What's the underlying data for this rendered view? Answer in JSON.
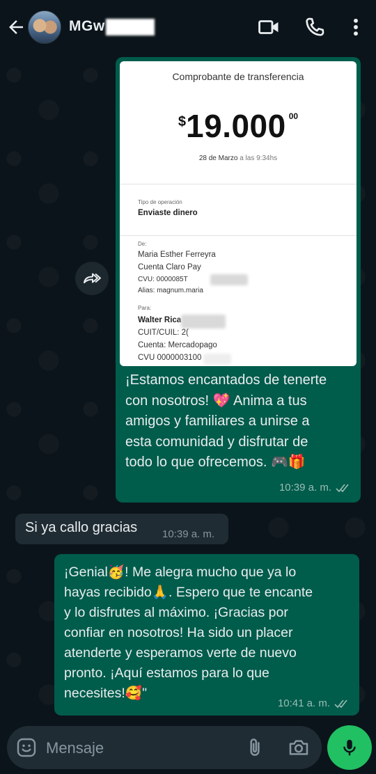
{
  "header": {
    "contact_name": "MGw",
    "icons": [
      "back-arrow-icon",
      "video-camera-icon",
      "phone-icon",
      "more-vert-icon"
    ]
  },
  "receipt": {
    "title": "Comprobante de transferencia",
    "currency": "$",
    "amount": "19.000",
    "cents": "00",
    "date_main": "28 de Marzo",
    "date_rest": " a las 9:34hs",
    "op_label": "Tipo de operación",
    "op_value": "Enviaste dinero",
    "from_label": "De:",
    "from_name": "Maria Esther Ferreyra",
    "from_account": "Cuenta Claro Pay",
    "from_cvu": "CVU: 0000085T",
    "from_alias": "Alias: magnum.maria",
    "to_label": "Para:",
    "to_name": "Walter Rica",
    "to_cuit": "CUIT/CUIL: 2(",
    "to_account": "Cuenta: Mercadopago",
    "to_cvu": "CVU 0000003100"
  },
  "messages": [
    {
      "direction": "out",
      "text": "¡Estamos encantados de tenerte\ncon nosotros! 💖 Anima a tus\namigos y familiares a unirse a\nesta comunidad y disfrutar de\ntodo lo que ofrecemos. 🎮🎁",
      "time": "10:39 a. m.",
      "status": "read"
    },
    {
      "direction": "in",
      "text": "Si ya callo gracias",
      "time": "10:39 a. m."
    },
    {
      "direction": "out",
      "text": "¡Genial🥳! Me alegra mucho que ya lo\nhayas recibido🙏. Espero que te encante\ny lo disfrutes al máximo. ¡Gracias por\nconfiar en nosotros! Ha sido un placer\natenderte y esperamos verte de nuevo\npronto. ¡Aquí estamos para lo que\nnecesites!🥰\"",
      "time": "10:41 a. m.",
      "status": "read"
    }
  ],
  "composer": {
    "placeholder": "Mensaje",
    "icons": [
      "emoji-icon",
      "paperclip-icon",
      "camera-icon",
      "microphone-icon"
    ]
  },
  "colors": {
    "background": "#0b141a",
    "outgoing_bubble": "#005c4b",
    "incoming_bubble": "#202c33",
    "accent_green": "#21c063"
  }
}
